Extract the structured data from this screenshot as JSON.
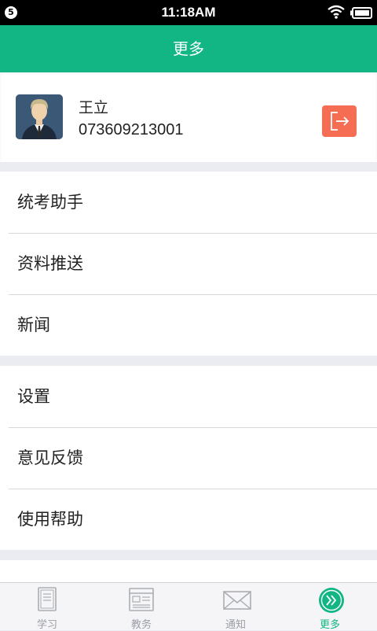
{
  "status_bar": {
    "badge": "5",
    "time": "11:18AM"
  },
  "header": {
    "title": "更多"
  },
  "profile": {
    "name": "王立",
    "id": "073609213001"
  },
  "menu": {
    "group1": [
      {
        "label": "统考助手"
      },
      {
        "label": "资料推送"
      },
      {
        "label": "新闻"
      }
    ],
    "group2": [
      {
        "label": "设置"
      },
      {
        "label": "意见反馈"
      },
      {
        "label": "使用帮助"
      }
    ]
  },
  "tabs": [
    {
      "label": "学习",
      "icon": "book-icon"
    },
    {
      "label": "教务",
      "icon": "browser-window-icon"
    },
    {
      "label": "通知",
      "icon": "envelope-icon"
    },
    {
      "label": "更多",
      "icon": "double-chevron-right-icon",
      "active": true
    }
  ],
  "colors": {
    "primary": "#12b584",
    "logout": "#f56e53",
    "background": "#ebecf1",
    "tab_inactive": "#9a9ea5"
  }
}
